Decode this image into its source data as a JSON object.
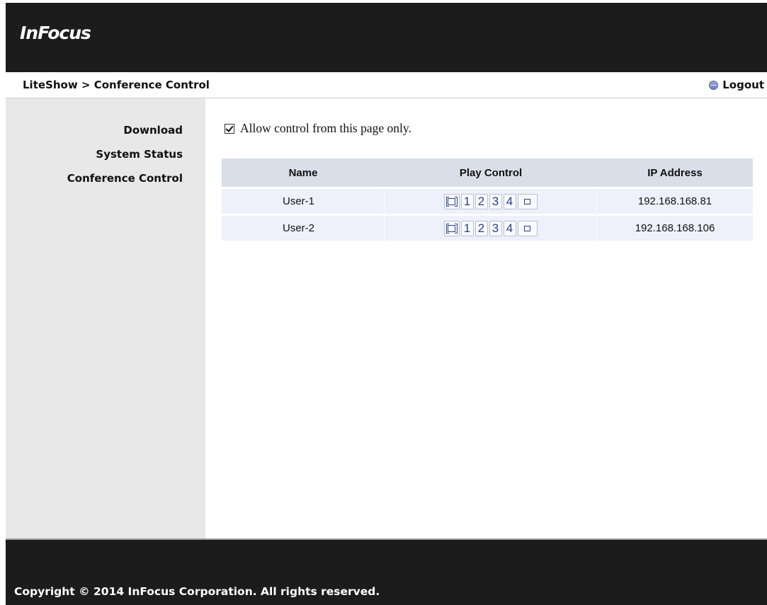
{
  "header": {
    "logo_text": "InFocus"
  },
  "breadcrumb": {
    "text": "LiteShow > Conference Control"
  },
  "logout": {
    "label": "Logout"
  },
  "sidebar": {
    "items": [
      {
        "label": "Download"
      },
      {
        "label": "System Status"
      },
      {
        "label": "Conference Control"
      }
    ]
  },
  "main": {
    "allow_control": {
      "label": "Allow control from this page only.",
      "checked": true
    },
    "table": {
      "headers": [
        "Name",
        "Play Control",
        "IP Address"
      ],
      "rows": [
        {
          "name": "User-1",
          "ip": "192.168.168.81"
        },
        {
          "name": "User-2",
          "ip": "192.168.168.106"
        }
      ],
      "play_buttons": [
        "1",
        "2",
        "3",
        "4"
      ]
    }
  },
  "footer": {
    "copyright": "Copyright © 2014 InFocus Corporation. All rights reserved."
  },
  "colors": {
    "header_bg": "#1c1c1c",
    "sidebar_bg": "#e8e8e8",
    "table_header_bg": "#d8dfe8",
    "table_row_bg": "#eef1fb",
    "play_button_text": "#2a3f86"
  }
}
